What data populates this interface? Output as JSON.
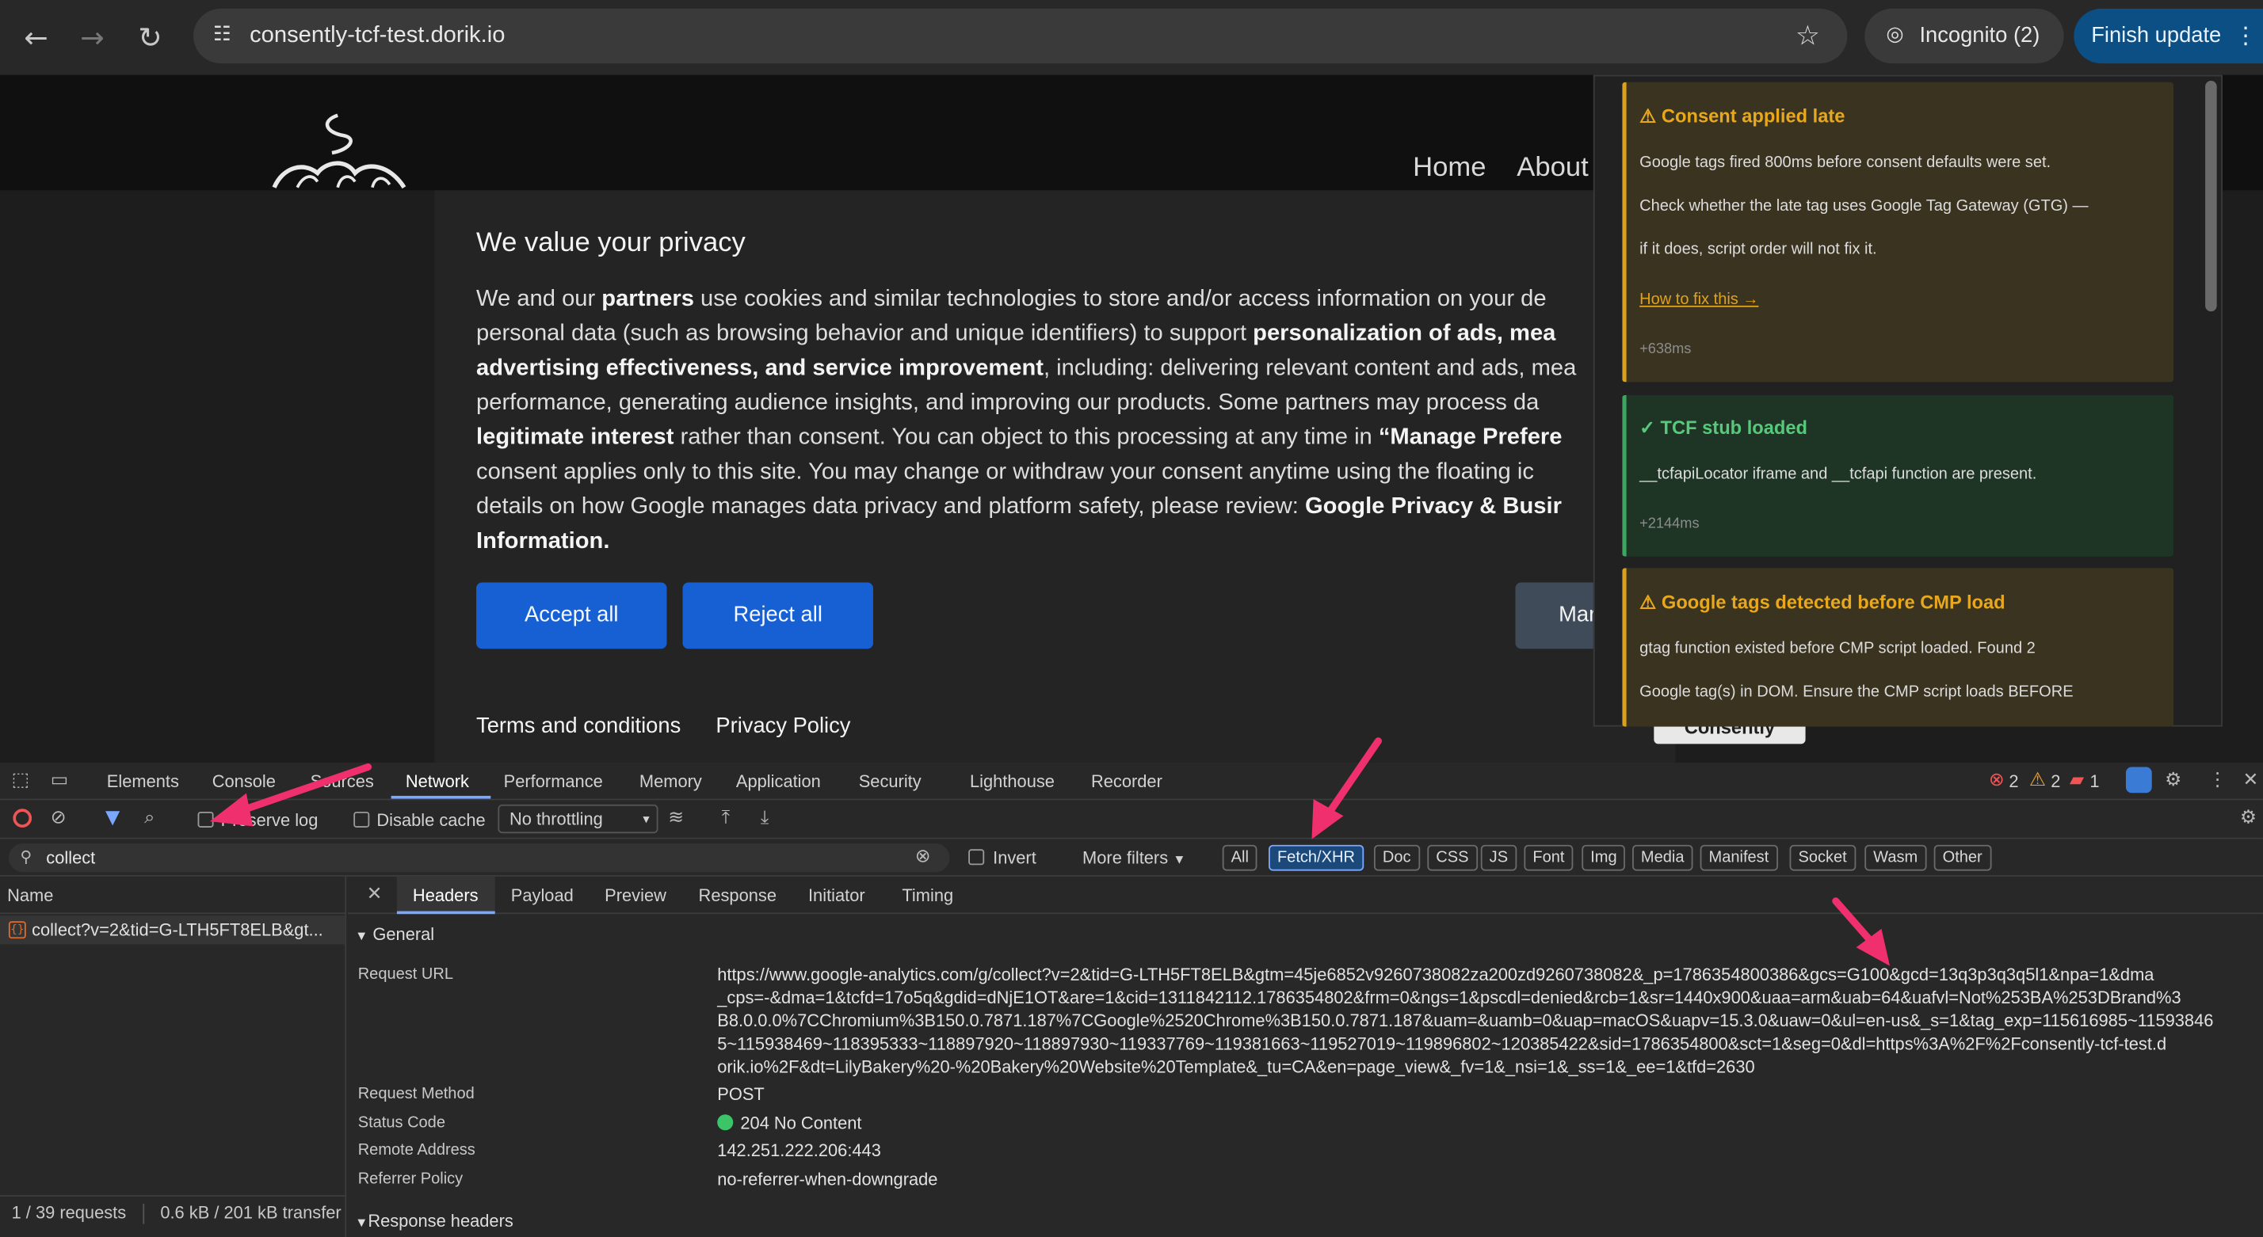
{
  "browser": {
    "url": "consently-tcf-test.dorik.io",
    "incognito_label": "Incognito (2)",
    "finish_update_label": "Finish update",
    "icons": [
      "back-arrow-icon",
      "forward-arrow-icon",
      "reload-icon",
      "site-info-icon",
      "bookmark-star-icon",
      "incognito-icon",
      "kebab-menu-icon"
    ]
  },
  "site": {
    "menu": [
      "Home",
      "About"
    ],
    "privacy_title": "We value your privacy",
    "privacy_lines": [
      [
        "We and our ",
        "partners",
        " use cookies and similar technologies to store and/or access information on your de"
      ],
      [
        "personal data (such as browsing behavior and unique identifiers) to support ",
        "personalization of ads, mea",
        ""
      ],
      [
        "",
        "advertising effectiveness, and service improvement",
        ", including: delivering relevant content and ads, mea"
      ],
      [
        "performance, generating audience insights, and improving our products. Some partners may process da",
        "",
        ""
      ],
      [
        "",
        "legitimate interest",
        " rather than consent. You can object to this processing at any time in "
      ],
      [
        "consent applies only to this site. You may change or withdraw your consent anytime using the floating ic",
        "",
        ""
      ],
      [
        "details on how Google manages data privacy and platform safety, please review: ",
        "Google Privacy & Busir",
        ""
      ],
      [
        "",
        "Information.",
        ""
      ]
    ],
    "manage_preferences_fragment": "“Manage Prefere",
    "accept_label": "Accept all",
    "reject_label": "Reject all",
    "manage_label": "Mar",
    "terms_label": "Terms and conditions",
    "privacy_policy_label": "Privacy Policy",
    "consently_logo": "Consently"
  },
  "extension_panel": {
    "cards": [
      {
        "type": "warning",
        "title": "⚠ Consent applied late",
        "lines": [
          "Google tags fired 800ms before consent defaults were set.",
          "Check whether the late tag uses Google Tag Gateway (GTG) —",
          "if it does, script order will not fix it."
        ],
        "link": "How to fix this →",
        "time": "+638ms"
      },
      {
        "type": "success",
        "title": "✓ TCF stub loaded",
        "lines": [
          "__tcfapiLocator iframe and __tcfapi function are present."
        ],
        "time": "+2144ms"
      },
      {
        "type": "warning",
        "title": "⚠ Google tags detected before CMP load",
        "lines": [
          "gtag function existed before CMP script loaded. Found 2",
          "Google tag(s) in DOM. Ensure the CMP script loads BEFORE"
        ]
      }
    ]
  },
  "devtools": {
    "tabs": [
      "Elements",
      "Console",
      "Sources",
      "Network",
      "Performance",
      "Memory",
      "Application",
      "Security",
      "Lighthouse",
      "Recorder"
    ],
    "active_tab": "Network",
    "counts": {
      "errors": "2",
      "warnings": "2",
      "issues": "1"
    },
    "toolbar": {
      "preserve_log": "Preserve log",
      "disable_cache": "Disable cache",
      "throttling": "No throttling"
    },
    "filter": {
      "value": "collect",
      "invert": "Invert",
      "more_filters": "More filters",
      "types": [
        "All",
        "Fetch/XHR",
        "Doc",
        "CSS",
        "JS",
        "Font",
        "Img",
        "Media",
        "Manifest",
        "Socket",
        "Wasm",
        "Other"
      ],
      "selected_type": "Fetch/XHR"
    },
    "request_list": {
      "header": "Name",
      "rows": [
        "collect?v=2&tid=G-LTH5FT8ELB&gt..."
      ],
      "status": "1 / 39 requests",
      "transfer": "0.6 kB / 201 kB transfer"
    },
    "detail_tabs": [
      "Headers",
      "Payload",
      "Preview",
      "Response",
      "Initiator",
      "Timing"
    ],
    "active_detail_tab": "Headers",
    "general": {
      "section_label": "General",
      "request_url_label": "Request URL",
      "request_url_lines": [
        "https://www.google-analytics.com/g/collect?v=2&tid=G-LTH5FT8ELB&gtm=45je6852v9260738082za200zd9260738082&_p=1786354800386&gcs=G100&gcd=13q3p3q3q5l1&npa=1&dma",
        "_cps=-&dma=1&tcfd=17o5q&gdid=dNjE1OT&are=1&cid=1311842112.1786354802&frm=0&ngs=1&pscdl=denied&rcb=1&sr=1440x900&uaa=arm&uab=64&uafvl=Not%253BA%253DBrand%3",
        "B8.0.0.0%7CChromium%3B150.0.7871.187%7CGoogle%2520Chrome%3B150.0.7871.187&uam=&uamb=0&uap=macOS&uapv=15.3.0&uaw=0&ul=en-us&_s=1&tag_exp=115616985~11593846",
        "5~115938469~118395333~118897920~118897930~119337769~119381663~119527019~119896802~120385422&sid=1786354800&sct=1&seg=0&dl=https%3A%2F%2Fconsently-tcf-test.d",
        "orik.io%2F&dt=LilyBakery%20-%20Bakery%20Website%20Template&_tu=CA&en=page_view&_fv=1&_nsi=1&_ss=1&_ee=1&tfd=2630"
      ],
      "request_method_label": "Request Method",
      "request_method": "POST",
      "status_code_label": "Status Code",
      "status_code": "204 No Content",
      "remote_address_label": "Remote Address",
      "remote_address": "142.251.222.206:443",
      "referrer_policy_label": "Referrer Policy",
      "referrer_policy": "no-referrer-when-downgrade"
    },
    "response_headers_label": "Response headers"
  },
  "colors": {
    "accent_blue": "#1760d4",
    "warning": "#d9a11d",
    "success": "#3ca562",
    "arrow_pink": "#f0306e"
  }
}
